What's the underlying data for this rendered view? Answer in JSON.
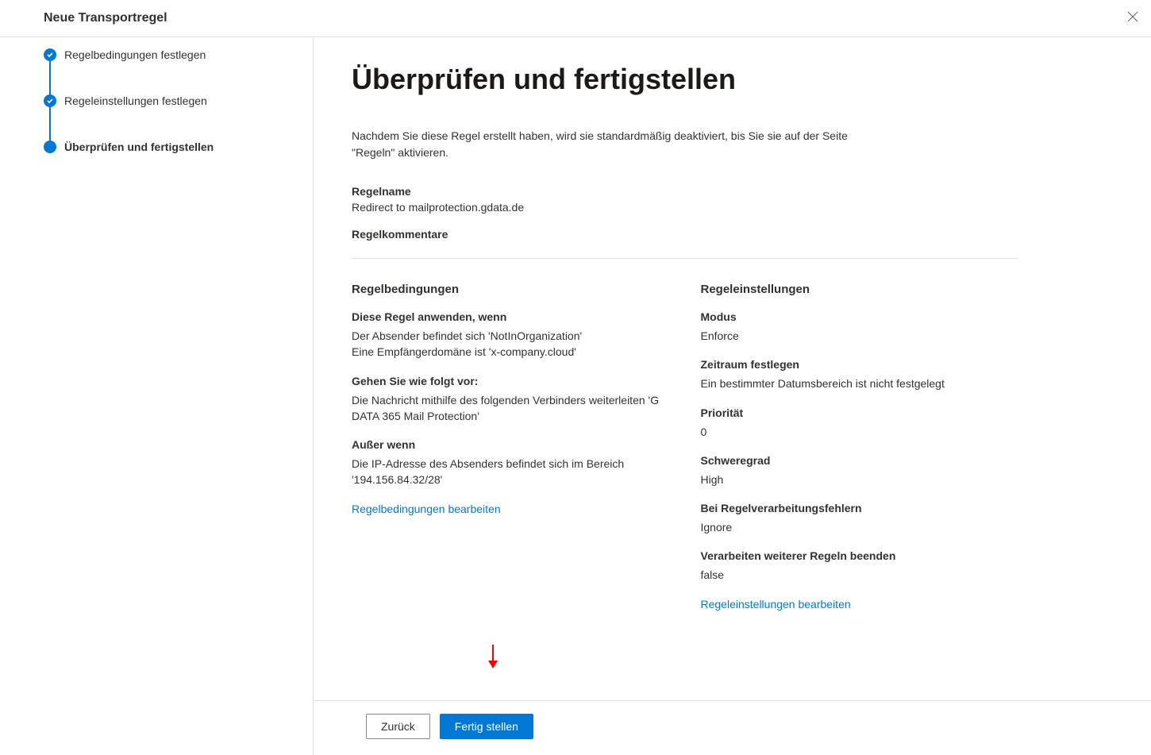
{
  "dialog": {
    "title": "Neue Transportregel"
  },
  "sidebar": {
    "steps": [
      {
        "label": "Regelbedingungen festlegen"
      },
      {
        "label": "Regeleinstellungen festlegen"
      },
      {
        "label": "Überprüfen und fertigstellen"
      }
    ]
  },
  "main": {
    "title": "Überprüfen und fertigstellen",
    "description": "Nachdem Sie diese Regel erstellt haben, wird sie standardmäßig deaktiviert, bis Sie sie auf der Seite \"Regeln\" aktivieren.",
    "rule_name_label": "Regelname",
    "rule_name_value": "Redirect to mailprotection.gdata.de",
    "rule_comment_label": "Regelkommentare",
    "left": {
      "header": "Regelbedingungen",
      "apply_when_label": "Diese Regel anwenden, wenn",
      "apply_when_text": "Der Absender befindet sich 'NotInOrganization'\nEine Empfängerdomäne ist 'x-company.cloud'",
      "do_following_label": "Gehen Sie wie folgt vor:",
      "do_following_text": "Die Nachricht mithilfe des folgenden Verbinders weiterleiten 'G DATA 365 Mail Protection'",
      "except_label": "Außer wenn",
      "except_text": "Die IP-Adresse des Absenders befindet sich im Bereich '194.156.84.32/28'",
      "edit_link": "Regelbedingungen bearbeiten"
    },
    "right": {
      "header": "Regeleinstellungen",
      "mode_label": "Modus",
      "mode_value": "Enforce",
      "period_label": "Zeitraum festlegen",
      "period_value": "Ein bestimmter Datumsbereich ist nicht festgelegt",
      "priority_label": "Priorität",
      "priority_value": "0",
      "severity_label": "Schweregrad",
      "severity_value": "High",
      "errors_label": "Bei Regelverarbeitungsfehlern",
      "errors_value": "Ignore",
      "stop_label": "Verarbeiten weiterer Regeln beenden",
      "stop_value": "false",
      "edit_link": "Regeleinstellungen bearbeiten"
    }
  },
  "footer": {
    "back": "Zurück",
    "finish": "Fertig stellen"
  }
}
